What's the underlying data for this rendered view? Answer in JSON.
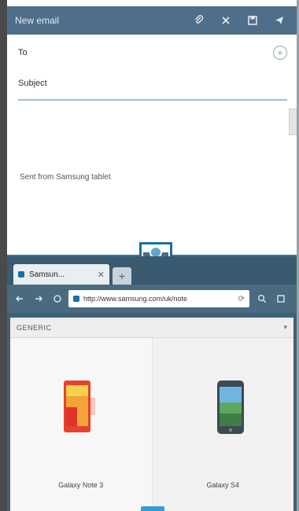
{
  "email": {
    "title": "New email",
    "to_label": "To",
    "subject_label": "Subject",
    "signature": "Sent from Samsung tablet",
    "icons": [
      "attach-icon",
      "delete-icon",
      "save-icon",
      "send-icon"
    ]
  },
  "browser": {
    "tab_label": "Samsun...",
    "tab_close": "✕",
    "new_tab": "+",
    "url": "http://www.samsung.com/uk/note",
    "section_label": "GENERIC",
    "section_chevron": "▾",
    "products": [
      {
        "name": "Galaxy Note 3"
      },
      {
        "name": "Galaxy S4"
      }
    ]
  },
  "colors": {
    "appbar": "#4f6e8a",
    "accent": "#1b6fa3",
    "divider": "#2f7aa8"
  }
}
